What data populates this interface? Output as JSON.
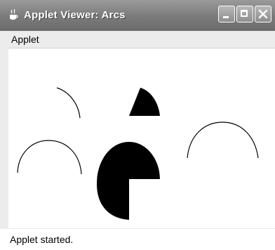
{
  "window": {
    "title": "Applet Viewer: Arcs",
    "buttons": {
      "minimize_icon": "minimize-icon",
      "maximize_icon": "maximize-icon",
      "close_icon": "close-icon"
    }
  },
  "menubar": {
    "items": [
      {
        "label": "Applet"
      }
    ]
  },
  "status": {
    "text": "Applet started."
  },
  "colors": {
    "titlebar": "#7a7a7a",
    "canvas": "#ffffff",
    "arc": "#000000"
  }
}
